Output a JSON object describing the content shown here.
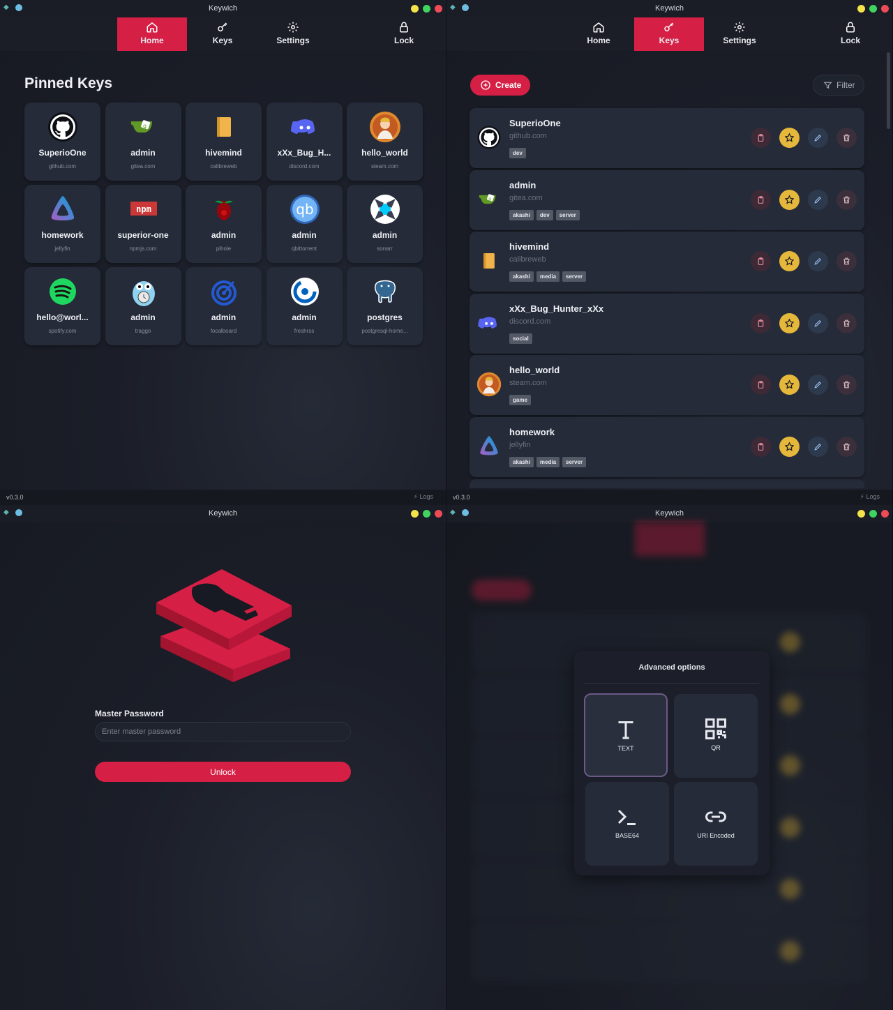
{
  "app": {
    "title": "Keywich",
    "version": "v0.3.0",
    "logs_label": "Logs"
  },
  "nav": {
    "home": "Home",
    "keys": "Keys",
    "settings": "Settings",
    "lock": "Lock"
  },
  "colors": {
    "accent": "#d61f45",
    "star": "#e5b73b",
    "card": "#252b39",
    "background": "#1b1e28"
  },
  "home": {
    "title": "Pinned Keys",
    "pinned": [
      {
        "name": "SuperioOne",
        "domain": "github.com",
        "icon": "github-icon"
      },
      {
        "name": "admin",
        "domain": "gitea.com",
        "icon": "gitea-icon"
      },
      {
        "name": "hivemind",
        "domain": "calibreweb",
        "icon": "book-icon"
      },
      {
        "name": "xXx_Bug_H...",
        "domain": "discord.com",
        "icon": "discord-icon"
      },
      {
        "name": "hello_world",
        "domain": "steam.com",
        "icon": "avatar-icon"
      },
      {
        "name": "homework",
        "domain": "jellyfin",
        "icon": "jellyfin-icon"
      },
      {
        "name": "superior-one",
        "domain": "npmjs.com",
        "icon": "npm-icon"
      },
      {
        "name": "admin",
        "domain": "pihole",
        "icon": "pihole-icon"
      },
      {
        "name": "admin",
        "domain": "qbittorrent",
        "icon": "qbittorrent-icon"
      },
      {
        "name": "admin",
        "domain": "sonarr",
        "icon": "sonarr-icon"
      },
      {
        "name": "hello@worl...",
        "domain": "spotify.com",
        "icon": "spotify-icon"
      },
      {
        "name": "admin",
        "domain": "traggo",
        "icon": "gopher-icon"
      },
      {
        "name": "admin",
        "domain": "focalboard",
        "icon": "target-icon"
      },
      {
        "name": "admin",
        "domain": "freshrss",
        "icon": "rss-icon"
      },
      {
        "name": "postgres",
        "domain": "postgresql-home...",
        "icon": "postgres-icon"
      }
    ]
  },
  "keys": {
    "create_label": "Create",
    "filter_label": "Filter",
    "items": [
      {
        "name": "SuperioOne",
        "domain": "github.com",
        "tags": [
          "dev"
        ],
        "icon": "github-icon"
      },
      {
        "name": "admin",
        "domain": "gitea.com",
        "tags": [
          "akashi",
          "dev",
          "server"
        ],
        "icon": "gitea-icon"
      },
      {
        "name": "hivemind",
        "domain": "calibreweb",
        "tags": [
          "akashi",
          "media",
          "server"
        ],
        "icon": "book-icon"
      },
      {
        "name": "xXx_Bug_Hunter_xXx",
        "domain": "discord.com",
        "tags": [
          "social"
        ],
        "icon": "discord-icon"
      },
      {
        "name": "hello_world",
        "domain": "steam.com",
        "tags": [
          "game"
        ],
        "icon": "avatar-icon"
      },
      {
        "name": "homework",
        "domain": "jellyfin",
        "tags": [
          "akashi",
          "media",
          "server"
        ],
        "icon": "jellyfin-icon"
      }
    ]
  },
  "unlock": {
    "label": "Master Password",
    "placeholder": "Enter master password",
    "button": "Unlock"
  },
  "advanced": {
    "title": "Advanced options",
    "options": [
      {
        "label": "TEXT",
        "icon": "text-icon",
        "selected": true
      },
      {
        "label": "QR",
        "icon": "qr-icon",
        "selected": false
      },
      {
        "label": "BASE64",
        "icon": "terminal-icon",
        "selected": false
      },
      {
        "label": "URI Encoded",
        "icon": "link-icon",
        "selected": false
      }
    ]
  }
}
